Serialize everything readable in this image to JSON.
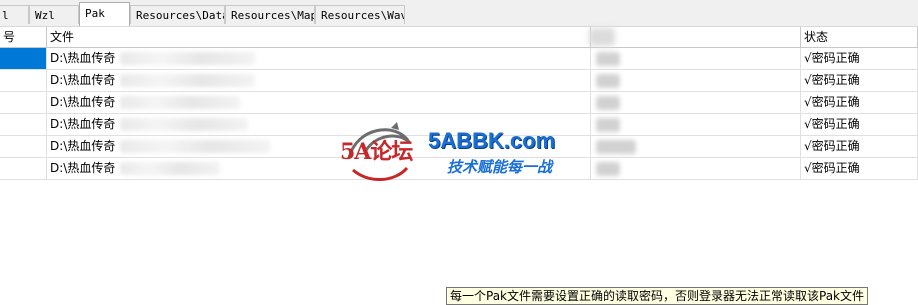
{
  "tabs": [
    {
      "label": "l",
      "active": false
    },
    {
      "label": "Wzl",
      "active": false
    },
    {
      "label": "Pak",
      "active": true
    },
    {
      "label": "Resources\\Data",
      "active": false
    },
    {
      "label": "Resources\\Map",
      "active": false
    },
    {
      "label": "Resources\\Wav",
      "active": false
    }
  ],
  "table": {
    "columns": [
      "号",
      "文件",
      "",
      "状态"
    ],
    "rows": [
      {
        "file": "D:\\热血传奇",
        "status": "√密码正确"
      },
      {
        "file": "D:\\热血传奇",
        "status": "√密码正确"
      },
      {
        "file": "D:\\热血传奇",
        "status": "√密码正确"
      },
      {
        "file": "D:\\热血传奇",
        "status": "√密码正确"
      },
      {
        "file": "D:\\热血传奇",
        "status": "√密码正确"
      },
      {
        "file": "D:\\热血传奇",
        "status": "√密码正确"
      }
    ]
  },
  "watermark": {
    "logo_text": "5A论坛",
    "site": "5ABBK.com",
    "slogan": "技术赋能每一战"
  },
  "tooltip": "每一个Pak文件需要设置正确的读取密码，否则登录器无法正常读取该Pak文件",
  "colors": {
    "selection": "#0078d7",
    "tab_bg": "#f0f0f0",
    "tooltip_bg": "#ffffe1",
    "watermark_blue": "#1a6fd6",
    "watermark_red": "#c62828"
  }
}
